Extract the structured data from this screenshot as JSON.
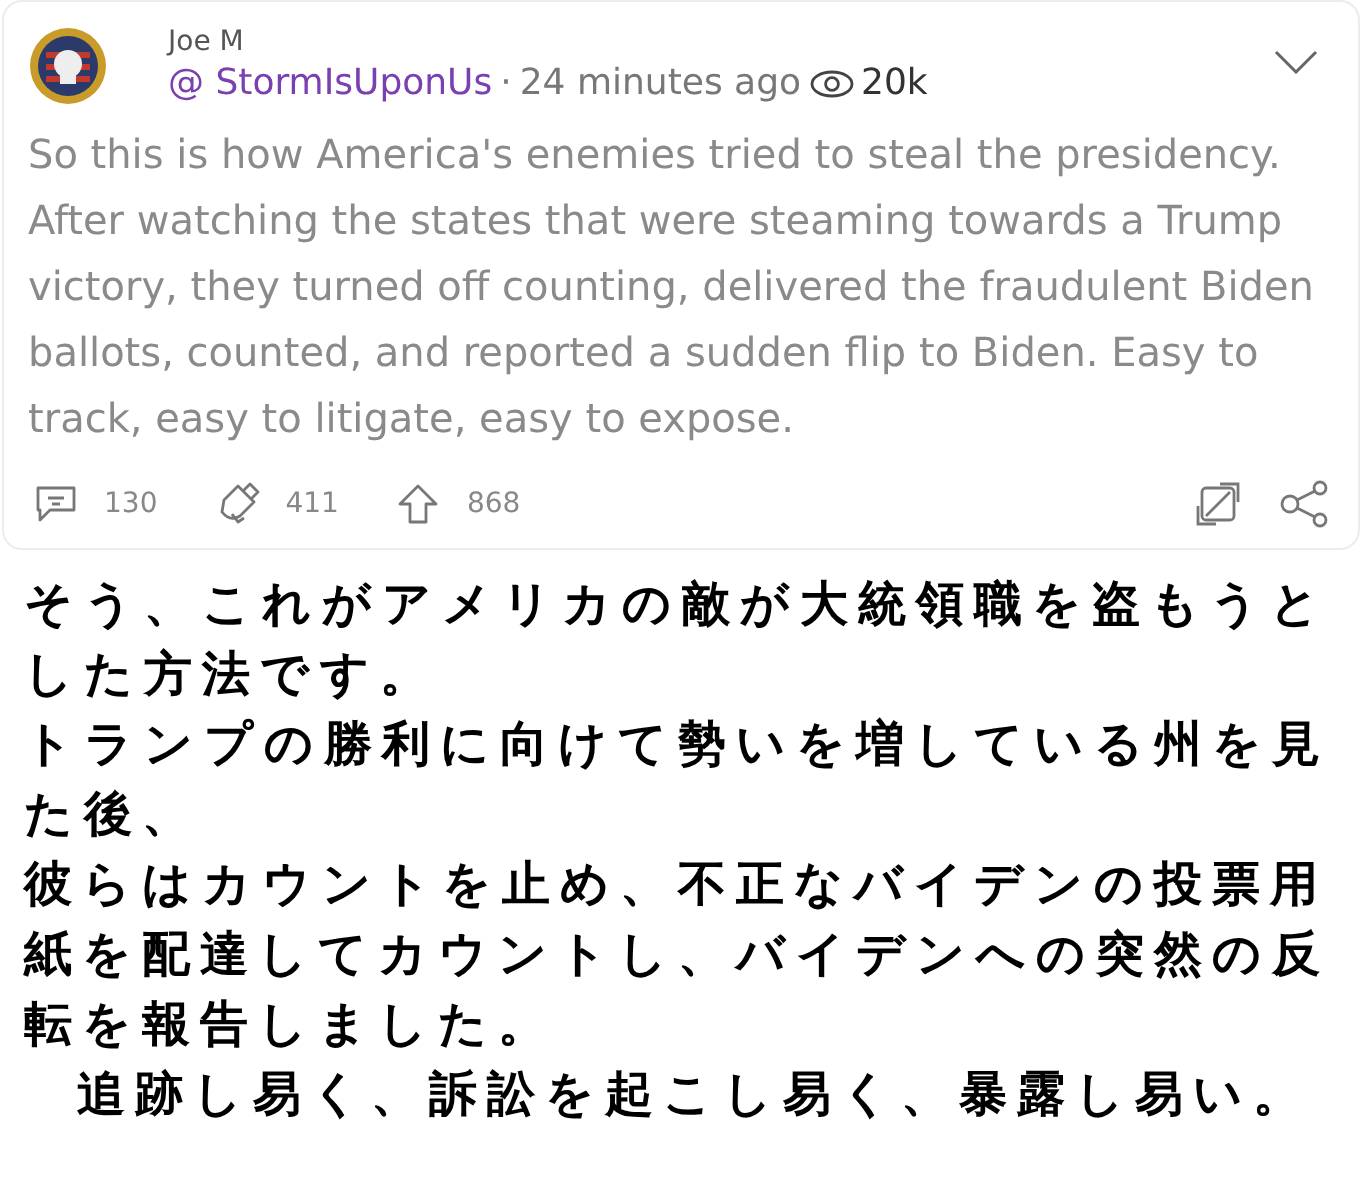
{
  "post": {
    "author": "Joe M",
    "handle": "@ StormIsUponUs",
    "separator": "·",
    "time": "24 minutes ago",
    "views": "20k",
    "text": "So this is how America's enemies tried to steal the presidency. After watching the states that were steaming towards a Trump victory, they turned off counting, delivered the fraudulent Biden ballots, counted, and reported a sudden flip to Biden. Easy to track, easy to litigate, easy to expose.",
    "actions": [
      {
        "kind": "comment",
        "count": "130"
      },
      {
        "kind": "repost",
        "count": "411"
      },
      {
        "kind": "upvote",
        "count": "868"
      }
    ]
  },
  "translation": [
    "そう、これがアメリカの敵が大統領職を盗もうと",
    "した方法です。",
    "トランプの勝利に向けて勢いを増している州を見",
    "た後、",
    "彼らはカウントを止め、不正なバイデンの投票用",
    "紙を配達してカウントし、バイデンへの突然の反",
    "転を報告しました。",
    "  追跡し易く、訴訟を起こし易く、暴露し易い。"
  ]
}
